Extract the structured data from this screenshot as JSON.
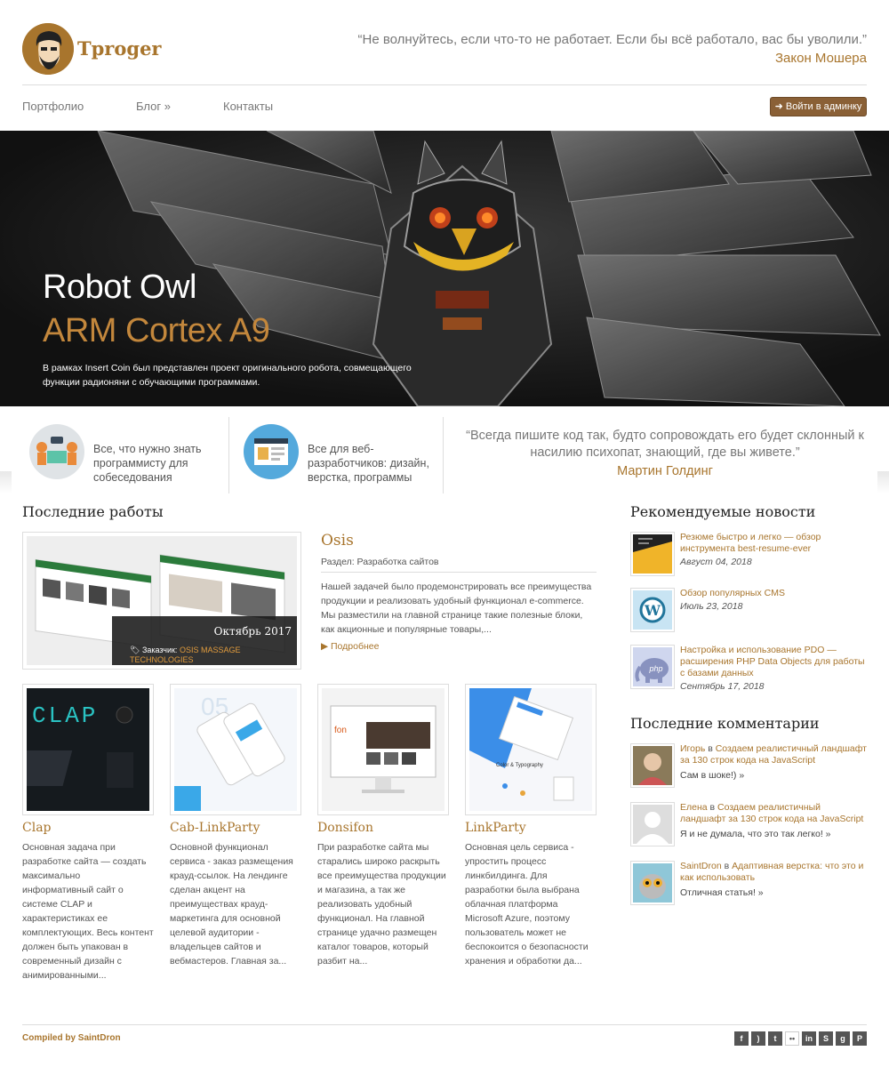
{
  "site": {
    "brand": "Tproger"
  },
  "header_quote": {
    "text": "“Не волнуйтесь, если что-то не работает. Если бы всё работало, вас бы уволили.”",
    "author": "Закон Мошера"
  },
  "nav": {
    "items": [
      "Портфолио",
      "Блог »",
      "Контакты"
    ],
    "admin_button": "Войти в админку"
  },
  "hero": {
    "title": "Robot Owl",
    "subtitle": "ARM Cortex A9",
    "description": "В рамках Insert Coin был представлен проект оригинального робота, совмещающего функции радионяни с обучающими программами."
  },
  "features": [
    {
      "text": "Все, что нужно знать программисту для собеседования"
    },
    {
      "text": "Все для веб-разработчиков: дизайн, верстка, программы"
    }
  ],
  "strip_quote": {
    "text": "“Всегда пишите код так, будто сопровождать его будет склонный к насилию психопат, знающий, где вы живете.”",
    "author": "Мартин Голдинг"
  },
  "works_section": {
    "title": "Последние работы",
    "featured": {
      "date": "Октябрь 2017",
      "client_label": "Заказчик:",
      "client": "OSIS MASSAGE TECHNOLOGIES",
      "name": "Osis",
      "section": "Раздел: Разработка сайтов",
      "description": "Нашей задачей было продемонстрировать все преимущества продукции и реализовать удобный функционал e-commerce. Мы разместили на главной странице такие полезные блоки, как акционные и популярные товары,...",
      "more": "Подробнее"
    },
    "items": [
      {
        "name": "Clap",
        "thumb_text": "CLAP",
        "description": "Основная задача при разработке сайта — создать максимально информативный сайт о системе CLAP и характеристиках ее комплектующих. Весь контент должен быть упакован в современный дизайн с анимированными..."
      },
      {
        "name": "Cab-LinkParty",
        "thumb_text": "05",
        "description": "Основной функционал сервиса - заказ размещения крауд-ссылок. На лендинге сделан акцент на преимуществах крауд-маркетинга для основной целевой аудитории - владельцев сайтов и вебмастеров. Главная за..."
      },
      {
        "name": "Donsifon",
        "thumb_text": "fon",
        "description": "При разработке сайта мы старались широко раскрыть все преимущества продукции и магазина, а так же реализовать удобный функционал. На главной странице удачно размещен каталог товаров, который разбит на..."
      },
      {
        "name": "LinkParty",
        "thumb_text": "Color & Typography",
        "description": "Основная цель сервиса - упростить процесс линкбилдинга. Для разработки была выбрана облачная платформа Microsoft Azure, поэтому пользователь может не беспокоится о безопасности хранения и обработки да..."
      }
    ]
  },
  "news_section": {
    "title": "Рекомендуемые новости",
    "items": [
      {
        "title": "Резюме быстро и легко — обзор инструмента best-resume-ever",
        "date": "Август 04, 2018"
      },
      {
        "title": "Обзор популярных CMS",
        "date": "Июль 23, 2018"
      },
      {
        "title": "Настройка и использование PDO — расширения PHP Data Objects для работы с базами данных",
        "date": "Сентябрь 17, 2018"
      }
    ]
  },
  "comments_section": {
    "title": "Последние комментарии",
    "items": [
      {
        "author": "Игорь",
        "joiner": " в ",
        "post": "Создаем реалистичный ландшафт за 130 строк кода на JavaScript",
        "text": "Сам в шоке!) »"
      },
      {
        "author": "Елена",
        "joiner": " в ",
        "post": "Создаем реалистичный ландшафт за 130 строк кода на JavaScript",
        "text": "Я и не думала, что это так легко! »"
      },
      {
        "author": "SaintDron",
        "joiner": " в ",
        "post": "Адаптивная верстка: что это и как использовать",
        "text": "Отличная статья! »"
      }
    ]
  },
  "footer": {
    "credit": "Compiled by SaintDron",
    "social": [
      "f",
      "rss",
      "tw",
      "fl",
      "in",
      "sk",
      "g+",
      "p"
    ]
  },
  "colors": {
    "accent": "#a8752d",
    "button": "#8a6036",
    "hero_bg": "#161616"
  }
}
